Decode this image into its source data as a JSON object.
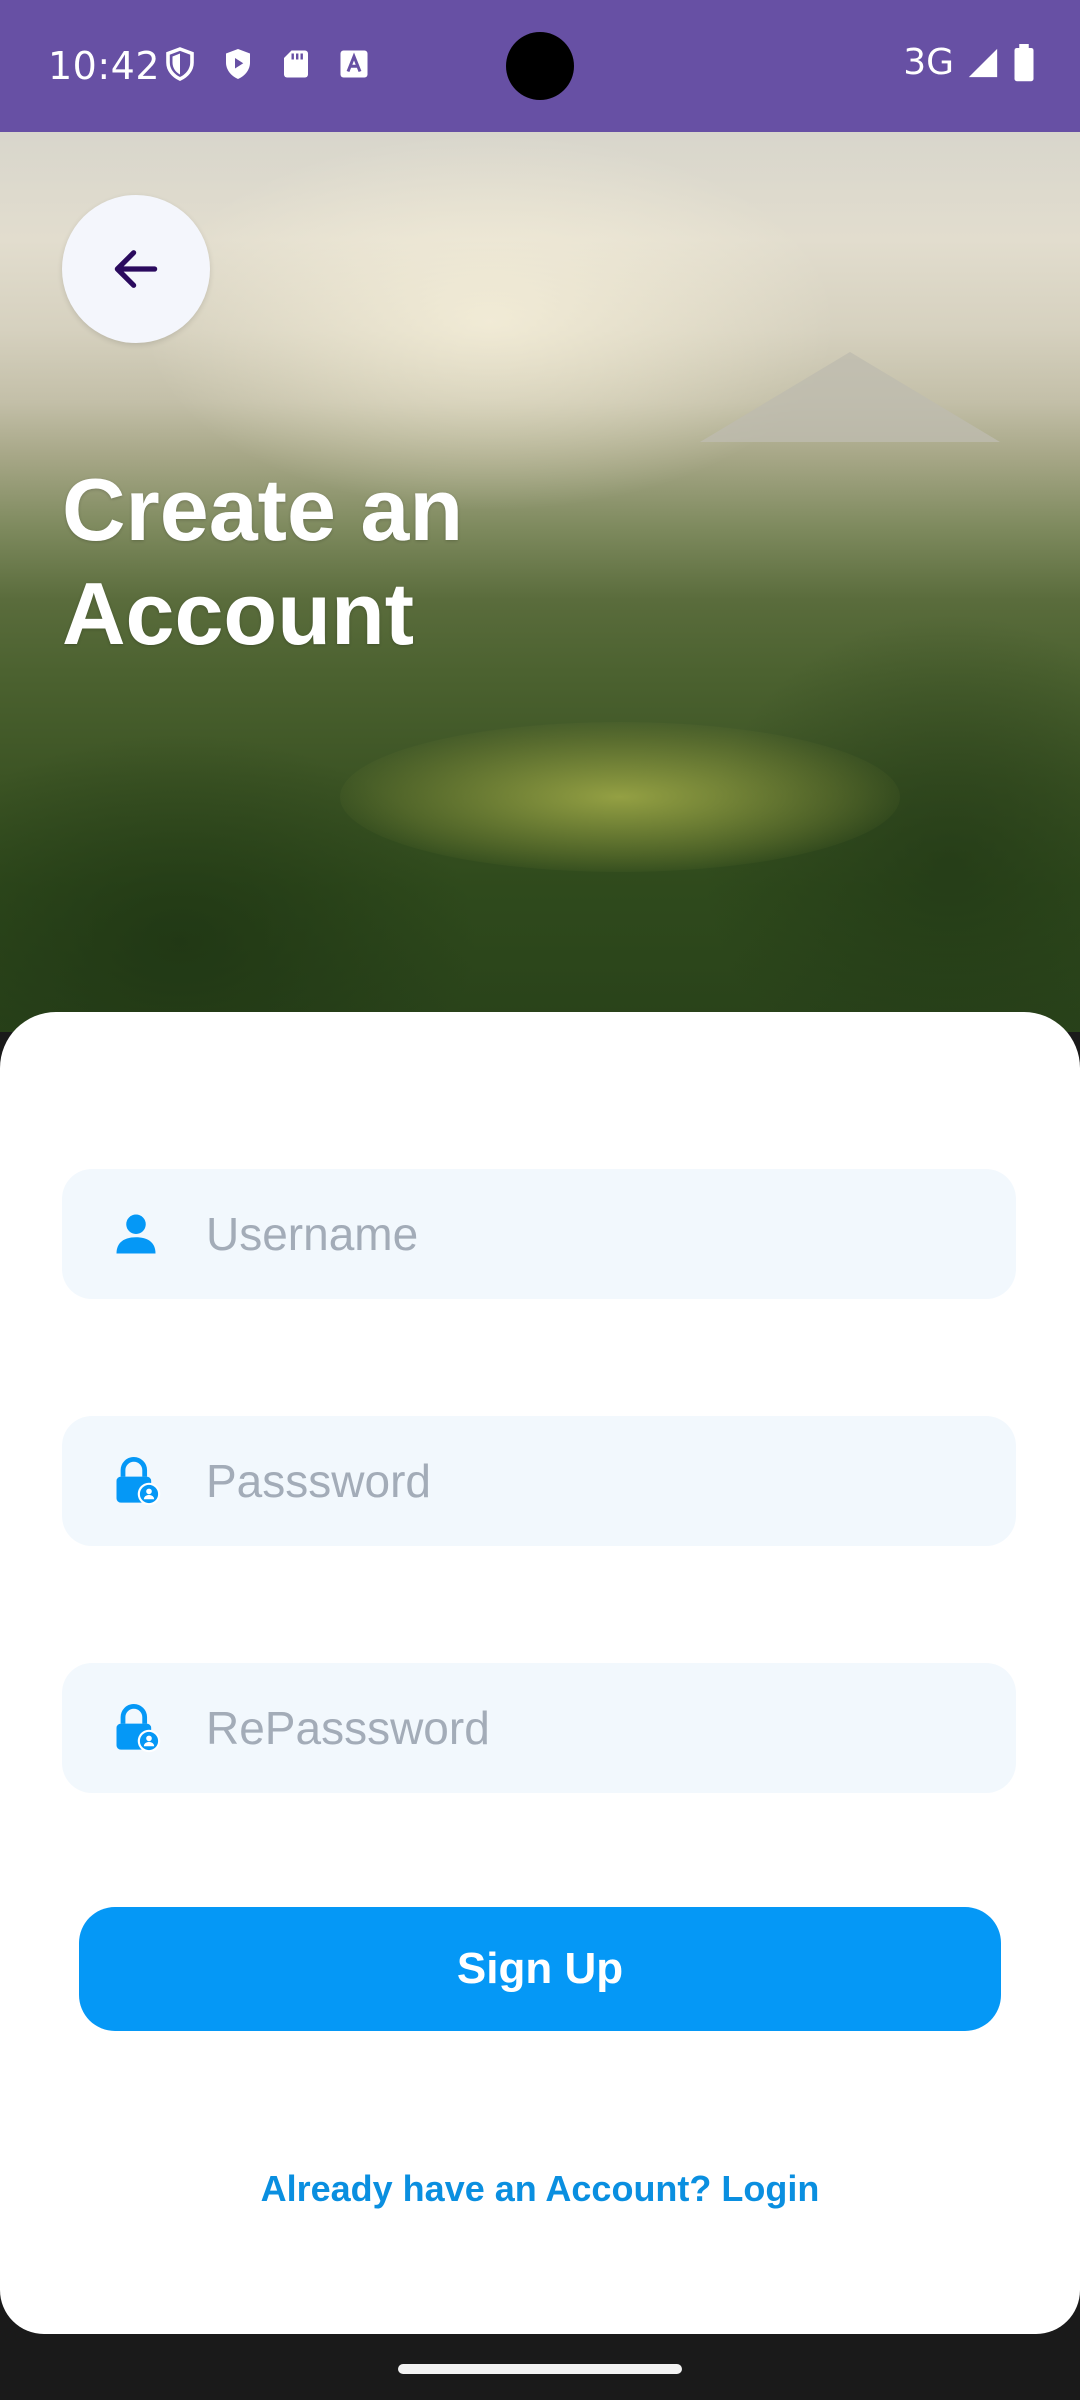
{
  "status_bar": {
    "time": "10:42",
    "network": "3G",
    "left_icons": [
      "shield-icon",
      "play-protect-icon",
      "sd-card-icon",
      "font-a-icon"
    ],
    "background": "#6750a4"
  },
  "header": {
    "back_icon": "arrow-left-icon",
    "title_line1": "Create an",
    "title_line2": "Account"
  },
  "form": {
    "username": {
      "placeholder": "Username",
      "value": "",
      "icon": "user-icon"
    },
    "password": {
      "placeholder": "Passsword",
      "value": "",
      "icon": "lock-user-icon"
    },
    "repassword": {
      "placeholder": "RePasssword",
      "value": "",
      "icon": "lock-user-icon"
    },
    "field_background": "#f2f8fd",
    "icon_color": "#0598f6"
  },
  "actions": {
    "signup_label": "Sign Up",
    "signup_color": "#0598f6",
    "login_link": "Already have an Account? Login"
  }
}
